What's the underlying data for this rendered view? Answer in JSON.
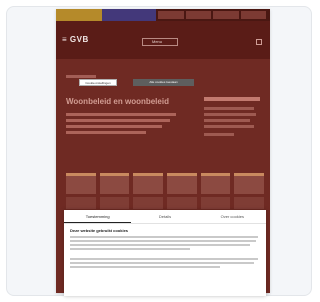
{
  "site": {
    "logo": "≡ GVB",
    "menu_label": "Menu",
    "heading": "Woonbeleid en woonbeleid"
  },
  "cookie": {
    "tabs": [
      "Toestemming",
      "Details",
      "Over cookies"
    ],
    "title": "Deze website gebruikt cookies",
    "settings_label": "Cookie-instellingen",
    "accept_label": "Alle cookies toestaan"
  }
}
